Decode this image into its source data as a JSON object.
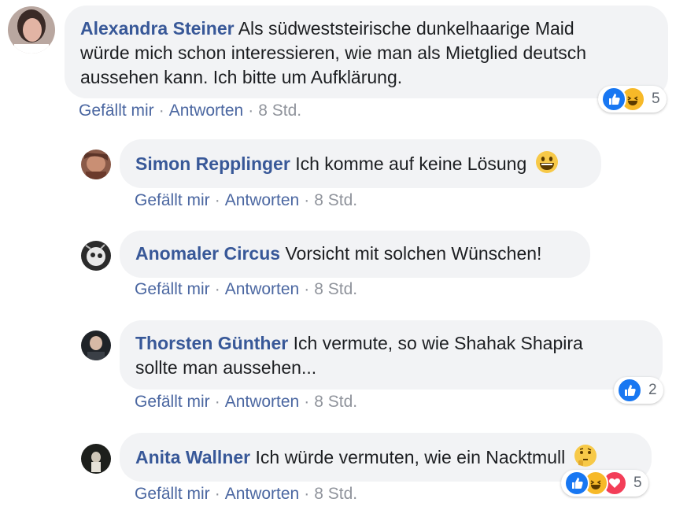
{
  "comments": [
    {
      "author": "Alexandra Steiner",
      "text_lines": [
        "Als südweststeirische dunkelhaarige Maid",
        "würde mich schon interessieren, wie man als Mietglied deutsch",
        "aussehen kann. Ich bitte um Aufklärung."
      ],
      "like_label": "Gefällt mir",
      "reply_label": "Antworten",
      "time": "8 Std.",
      "reaction_count": "5",
      "reaction_icons": [
        "like-icon",
        "haha-icon"
      ]
    },
    {
      "author": "Simon Repplinger",
      "text": "Ich komme auf keine Lösung",
      "emoji": "grinning-face-icon",
      "like_label": "Gefällt mir",
      "reply_label": "Antworten",
      "time": "8 Std."
    },
    {
      "author": "Anomaler Circus",
      "text": "Vorsicht mit solchen Wünschen!",
      "like_label": "Gefällt mir",
      "reply_label": "Antworten",
      "time": "8 Std."
    },
    {
      "author": "Thorsten Günther",
      "text_lines": [
        "Ich vermute, so wie Shahak Shapira",
        "sollte man aussehen..."
      ],
      "like_label": "Gefällt mir",
      "reply_label": "Antworten",
      "time": "8 Std.",
      "reaction_count": "2",
      "reaction_icons": [
        "like-icon"
      ]
    },
    {
      "author": "Anita Wallner",
      "text": "Ich würde vermuten, wie ein Nacktmull",
      "emoji": "thinking-face-icon",
      "like_label": "Gefällt mir",
      "reply_label": "Antworten",
      "time": "8 Std.",
      "reaction_count": "5",
      "reaction_icons": [
        "like-icon",
        "haha-icon",
        "love-icon"
      ]
    }
  ],
  "separator": "·",
  "colors": {
    "author": "#385898",
    "bubble": "#f2f3f5",
    "meta": "#90949c",
    "like_blue": "#1877f2",
    "haha_yellow": "#f7b928",
    "love_red": "#f33e58"
  }
}
